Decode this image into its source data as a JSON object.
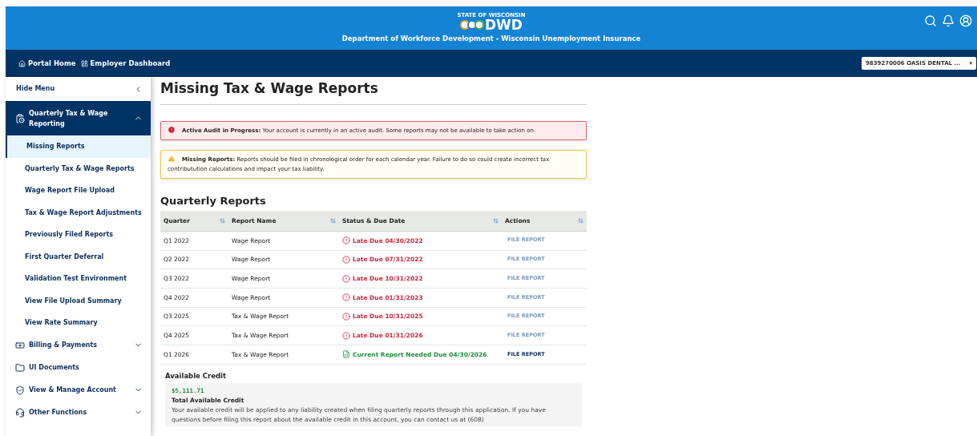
{
  "header": {
    "logo_top": "STATE OF WISCONSIN",
    "logo_text": "DWD",
    "title": "Department of Workforce Development - Wisconsin Unemployment Insurance"
  },
  "breadcrumbs": [
    "Portal Home",
    "Employer Dashboard"
  ],
  "account_select": {
    "value": "9839270006 OASIS DENTAL ...",
    "caret": "▾"
  },
  "sidebar": {
    "hide_label": "Hide Menu",
    "items": [
      {
        "label": "Quarterly Tax & Wage Reporting",
        "expanded": true,
        "children": [
          {
            "label": "Missing Reports",
            "selected": true
          },
          {
            "label": "Quarterly Tax & Wage Reports",
            "selected": false
          },
          {
            "label": "Wage Report File Upload",
            "selected": false
          },
          {
            "label": "Tax & Wage Report Adjustments",
            "selected": false
          },
          {
            "label": "Previously Filed Reports",
            "selected": false
          },
          {
            "label": "First Quarter Deferral",
            "selected": false
          },
          {
            "label": "Validation Test Environment",
            "selected": false
          },
          {
            "label": "View File Upload Summary",
            "selected": false
          },
          {
            "label": "View Rate Summary",
            "selected": false
          }
        ]
      },
      {
        "label": "Billing & Payments",
        "expanded": false
      },
      {
        "label": "UI Documents"
      },
      {
        "label": "View & Manage Account",
        "expanded": false
      },
      {
        "label": "Other Functions",
        "expanded": false
      }
    ]
  },
  "page_title": "Missing Tax & Wage Reports",
  "alerts": [
    {
      "kind": "error",
      "title": "Active Audit in Progress:",
      "text": "Your account is currently in an active audit. Some reports may not be available to take action on."
    },
    {
      "kind": "warning",
      "title": "Missing Reports:",
      "text": "Reports should be filed in chronological order for each calendar year. Failure to do so could create incorrect tax contributution calculations and impact your tax liability."
    }
  ],
  "table": {
    "title": "Quarterly Reports",
    "columns": [
      "Quarter",
      "Report Name",
      "Status & Due Date",
      "Actions"
    ],
    "rows": [
      {
        "quarter": "Q1 2022",
        "name": "Wage Report",
        "kind": "late",
        "status": "Late Due 04/30/2022",
        "action": "FILE REPORT",
        "disabled": true
      },
      {
        "quarter": "Q2 2022",
        "name": "Wage Report",
        "kind": "late",
        "status": "Late Due 07/31/2022",
        "action": "FILE REPORT",
        "disabled": true
      },
      {
        "quarter": "Q3 2022",
        "name": "Wage Report",
        "kind": "late",
        "status": "Late Due 10/31/2022",
        "action": "FILE REPORT",
        "disabled": true
      },
      {
        "quarter": "Q4 2022",
        "name": "Wage Report",
        "kind": "late",
        "status": "Late Due 01/31/2023",
        "action": "FILE REPORT",
        "disabled": true
      },
      {
        "quarter": "Q3 2025",
        "name": "Tax & Wage Report",
        "kind": "late",
        "status": "Late Due 10/31/2025",
        "action": "FILE REPORT",
        "disabled": true
      },
      {
        "quarter": "Q4 2025",
        "name": "Tax & Wage Report",
        "kind": "late",
        "status": "Late Due 01/31/2026",
        "action": "FILE REPORT",
        "disabled": true
      },
      {
        "quarter": "Q1 2026",
        "name": "Tax & Wage Report",
        "kind": "current",
        "status": "Current Report Needed Due 04/30/2026",
        "action": "FILE REPORT",
        "disabled": false
      }
    ]
  },
  "credit": {
    "heading": "Available Credit",
    "amount": "$5,111.71",
    "label": "Total Available Credit",
    "text": "Your available credit will be applied to any liability created when filing quarterly reports through this application. If you have questions before filing this report about the available credit in this account, you can contact us at (608)"
  }
}
